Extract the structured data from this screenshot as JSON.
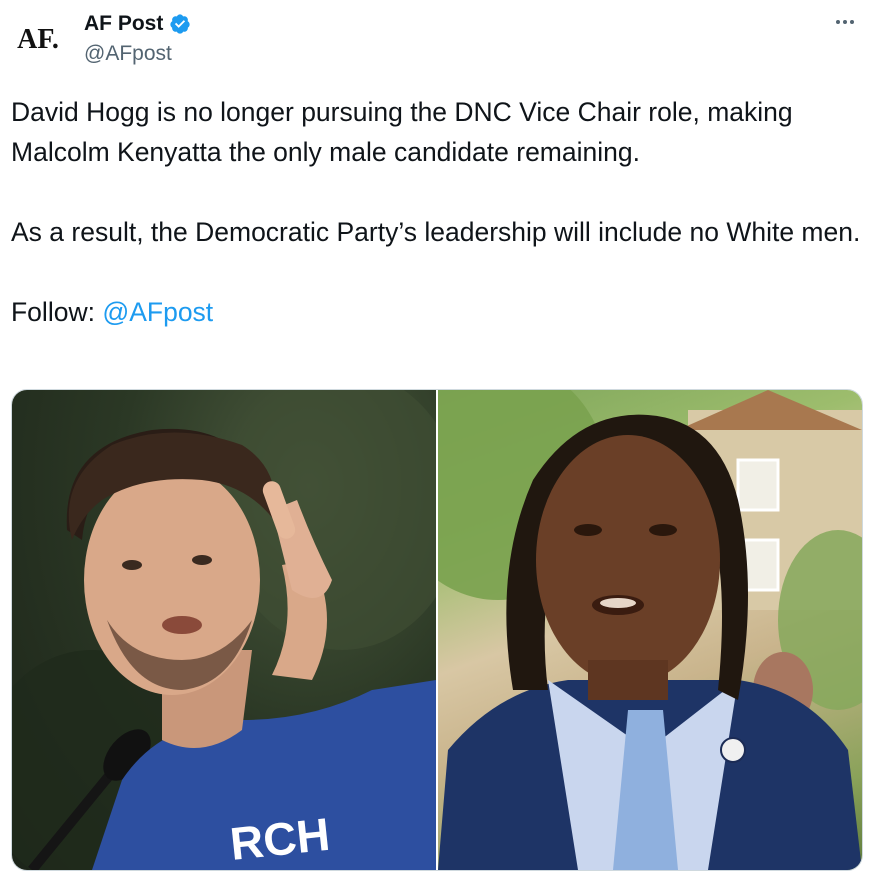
{
  "author": {
    "avatar_text": "AF.",
    "display_name": "AF Post",
    "verified_icon": "verified-badge-icon",
    "handle": "@AFpost"
  },
  "more_icon": "more-horizontal-icon",
  "tweet": {
    "paragraph_1": "David Hogg is no longer pursuing the DNC Vice Chair role, making Malcolm Kenyatta the only male candidate remaining.",
    "paragraph_2": "As a result, the Democratic Party’s leadership will include no White men.",
    "follow_label": "Follow: ",
    "follow_mention": "@AFpost"
  },
  "media": {
    "photos": [
      {
        "name": "photo-left",
        "shirt_text": "RCH"
      },
      {
        "name": "photo-right"
      }
    ]
  },
  "colors": {
    "text": "#0f1419",
    "secondary_text": "#536471",
    "link": "#1d9bf0",
    "verified": "#1d9bf0",
    "media_border": "#cfd9de"
  }
}
